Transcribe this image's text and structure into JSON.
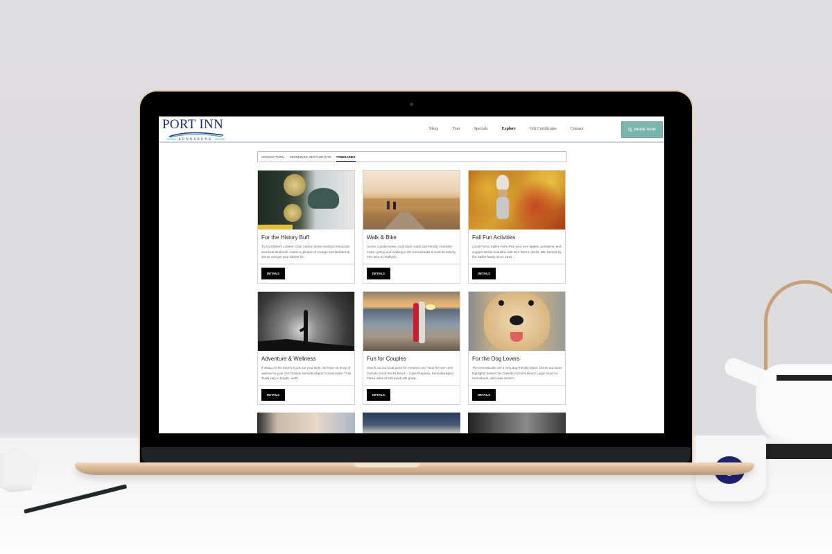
{
  "site": {
    "logo_title": "PORT INN",
    "logo_subtitle": "KENNEBUNK",
    "nav": [
      {
        "label": "Sleep",
        "active": false
      },
      {
        "label": "Tour",
        "active": false
      },
      {
        "label": "Specials",
        "active": false
      },
      {
        "label": "Explore",
        "active": true
      },
      {
        "label": "Gift Certificates",
        "active": false
      },
      {
        "label": "Contact",
        "active": false
      }
    ],
    "book_button": {
      "label": "BOOK NOW",
      "icon": "search-icon"
    },
    "colors": {
      "brand_navy": "#1d2f80",
      "book_teal": "#7bb5ac",
      "details_black": "#000000"
    }
  },
  "subtabs": [
    {
      "label": "AROUND TOWN",
      "active": false
    },
    {
      "label": "KENNEBUNK RESTAURANTS",
      "active": false
    },
    {
      "label": "ITINERARIES",
      "active": true
    }
  ],
  "cards": [
    {
      "title": "For the History Buff",
      "desc": "To Eat Mabel's Lobster Claw Classic Maine seafood restaurant and local landmark. Catch a glimpse of George and Barbara at dinner and get your lobster fix...",
      "button": "DETAILS",
      "image": "vintage-car-photo"
    },
    {
      "title": "Walk & Bike",
      "desc": "Scenic coastal views, rural back roads and friendly motorists make cycling and walking in the Kennebunks a must do activity. The area is relatively...",
      "button": "DETAILS",
      "image": "cyclists-path-photo"
    },
    {
      "title": "Fall Fun Activities",
      "desc": "Local Farms  Spiller Farm Pick your own apples, pumpkins, and veggies at this beautiful, 130 acre farm in Wells, ME, farmed by the Spiller family since 1914...",
      "button": "DETAILS",
      "image": "autumn-leaves-photo"
    },
    {
      "title": "Adventure & Wellness",
      "desc": "If sitting on the beach is just not your style, we have an array of options for you! Get Outside Kennebunkport Conservation Trust Trails vary in length, width,",
      "button": "DETAILS",
      "image": "yoga-silhouette-photo"
    },
    {
      "title": "Fun for Couples",
      "desc": "Check out our local picks for romance and \"time for two\"! Get Outside Good Rocks Beach - Cape Porpoise, Kennebunkport Three miles of soft sand with great...",
      "button": "DETAILS",
      "image": "couple-beach-sunset-photo"
    },
    {
      "title": "For the Dog Lovers",
      "desc": "The Kennebunks are a very dog-friendly place. Check out some highlights below! Get Outside Gooch's Beach Large beach in Kennebunk, with wide stretch...",
      "button": "DETAILS",
      "image": "golden-retriever-photo"
    }
  ]
}
